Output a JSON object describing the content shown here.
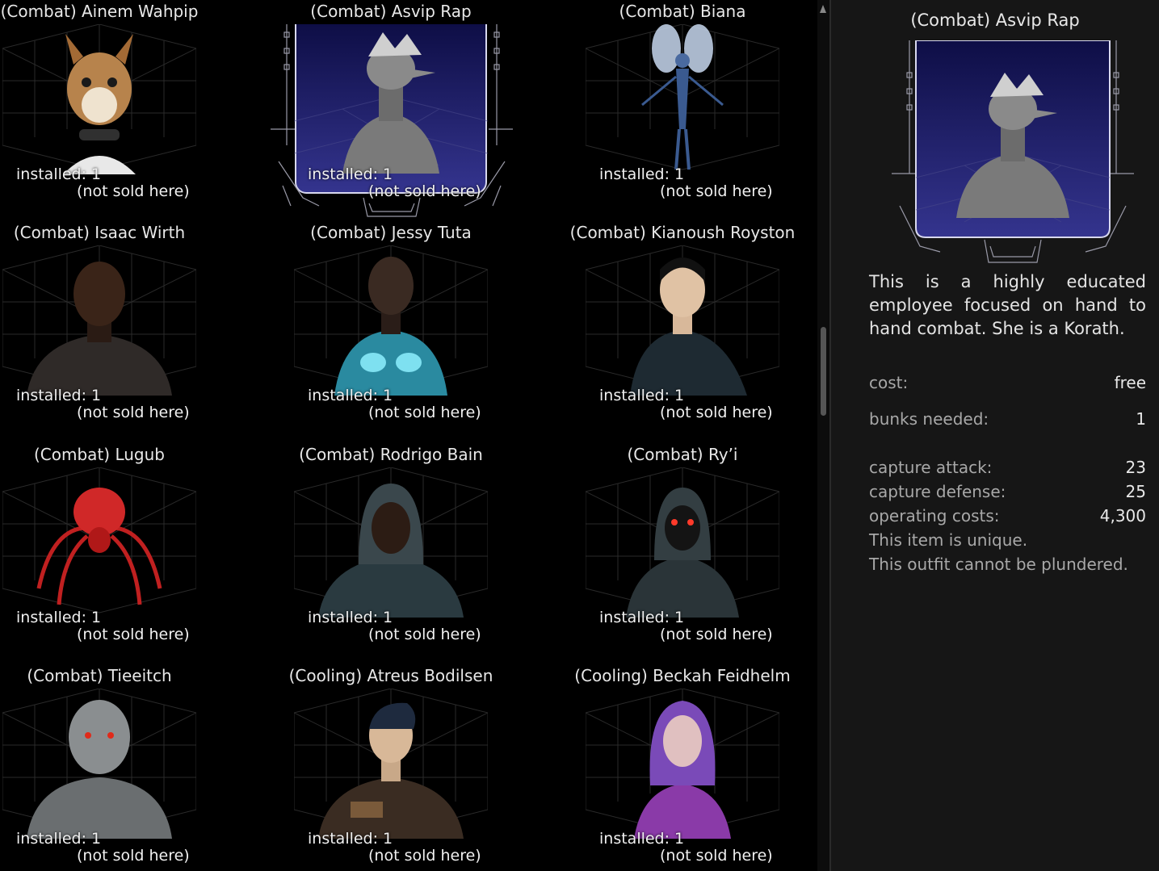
{
  "tiles": [
    {
      "title": "(Combat) Ainem Wahpip",
      "installed": "installed: 1",
      "sold": "(not sold here)",
      "icon": "squirrel-portrait"
    },
    {
      "title": "(Combat) Asvip Rap",
      "installed": "installed: 1",
      "sold": "(not sold here)",
      "icon": "lizard-alien-portrait"
    },
    {
      "title": "(Combat) Biana",
      "installed": "installed: 1",
      "sold": "(not sold here)",
      "icon": "winged-insect-portrait"
    },
    {
      "title": "(Combat) Isaac Wirth",
      "installed": "installed: 1",
      "sold": "(not sold here)",
      "icon": "dark-man-portrait"
    },
    {
      "title": "(Combat) Jessy Tuta",
      "installed": "installed: 1",
      "sold": "(not sold here)",
      "icon": "cyan-armored-woman-portrait"
    },
    {
      "title": "(Combat) Kianoush Royston",
      "installed": "installed: 1",
      "sold": "(not sold here)",
      "icon": "asian-man-portrait"
    },
    {
      "title": "(Combat) Lugub",
      "installed": "installed: 1",
      "sold": "(not sold here)",
      "icon": "red-spider-portrait"
    },
    {
      "title": "(Combat) Rodrigo Bain",
      "installed": "installed: 1",
      "sold": "(not sold here)",
      "icon": "hooded-man-portrait"
    },
    {
      "title": "(Combat) Ry’i",
      "installed": "installed: 1",
      "sold": "(not sold here)",
      "icon": "masked-hood-portrait"
    },
    {
      "title": "(Combat) Tieeitch",
      "installed": "installed: 1",
      "sold": "(not sold here)",
      "icon": "grey-alien-portrait"
    },
    {
      "title": "(Cooling) Atreus Bodilsen",
      "installed": "installed: 1",
      "sold": "(not sold here)",
      "icon": "young-man-portrait"
    },
    {
      "title": "(Cooling) Beckah Feidhelm",
      "installed": "installed: 1",
      "sold": "(not sold here)",
      "icon": "purple-hair-woman-portrait"
    }
  ],
  "selected_index": 1,
  "detail": {
    "title": "(Combat) Asvip Rap",
    "description": "This is a highly educated employee focused on hand to hand combat. She is a Korath.",
    "cost_label": "cost:",
    "cost_value": "free",
    "bunks_label": "bunks needed:",
    "bunks_value": "1",
    "attack_label": "capture attack:",
    "attack_value": "23",
    "defense_label": "capture defense:",
    "defense_value": "25",
    "operating_label": "operating costs:",
    "operating_value": "4,300",
    "unique_note": "This item is unique.",
    "plunder_note": "This outfit cannot be plundered."
  },
  "colors": {
    "selected_top": "#0e0e46",
    "selected_bottom": "#34348e",
    "panel_bg": "#161616",
    "label_grey": "#a8a8a8"
  }
}
